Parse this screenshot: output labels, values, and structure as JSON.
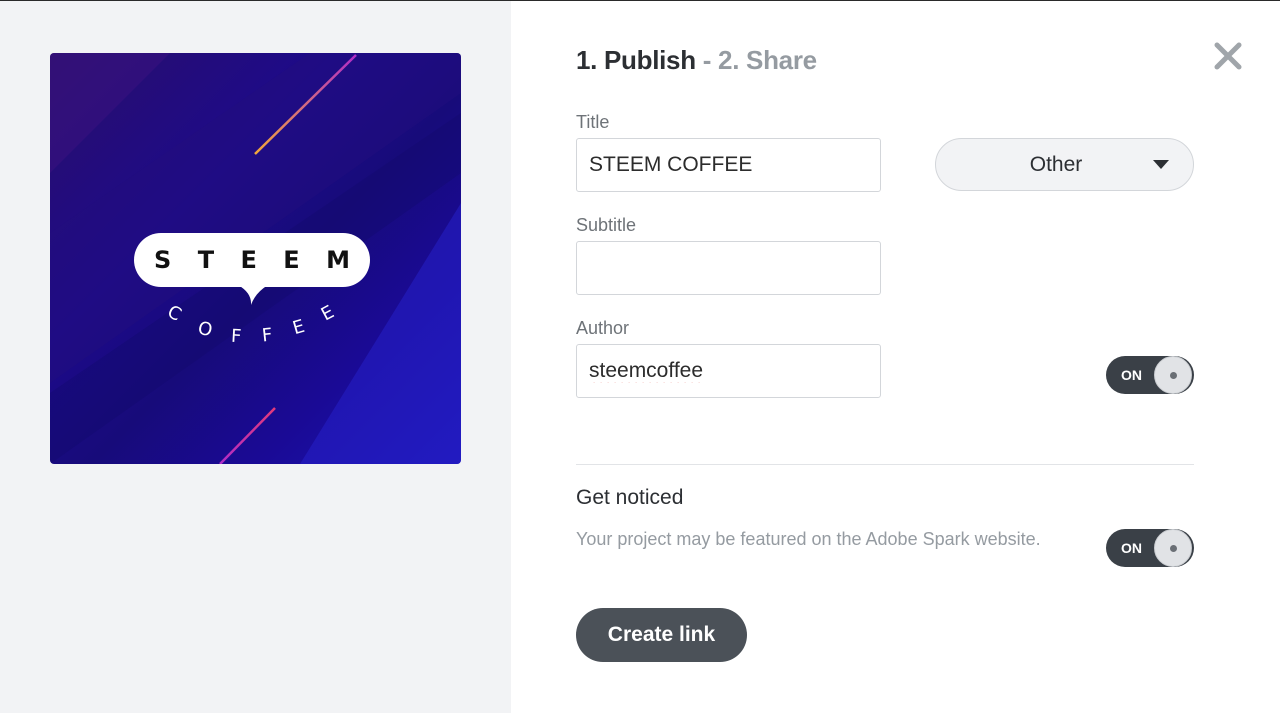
{
  "header": {
    "step1": "1. Publish",
    "separator": " - ",
    "step2": "2. Share"
  },
  "preview": {
    "logo_word": "STEEM",
    "logo_letters": [
      "S",
      "T",
      "E",
      "E",
      "M"
    ],
    "sub_letters": [
      "C",
      "O",
      "F",
      "F",
      "E",
      "E"
    ]
  },
  "form": {
    "title_label": "Title",
    "title_value": "STEEM COFFEE",
    "subtitle_label": "Subtitle",
    "subtitle_value": "",
    "author_label": "Author",
    "author_value": "steemcoffee",
    "category": "Other",
    "author_toggle": "ON"
  },
  "notice": {
    "title": "Get noticed",
    "description": "Your project may be featured on the Adobe Spark website.",
    "toggle": "ON"
  },
  "actions": {
    "create_link": "Create link"
  },
  "icons": {
    "close": "close-icon",
    "dropdown": "caret-down-icon"
  },
  "colors": {
    "primary_button": "#4b5158",
    "toggle_on": "#3a4047",
    "panel_bg": "#f2f3f5"
  }
}
